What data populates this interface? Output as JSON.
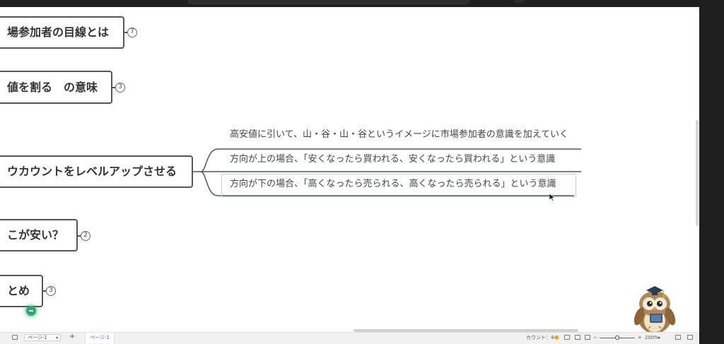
{
  "mindmap": {
    "nodes": [
      {
        "id": "node-market-view",
        "text": "場参加者の目線とは",
        "count": "7"
      },
      {
        "id": "node-value-divide",
        "text": "値を割る　の意味",
        "count": "3"
      },
      {
        "id": "node-level-up",
        "text": "ウカウントをレベルアップさせる",
        "count": ""
      },
      {
        "id": "node-where-cheap",
        "text": "こが安い？",
        "count": "2"
      },
      {
        "id": "node-summary",
        "text": "とめ",
        "count": "3"
      }
    ],
    "children": [
      "高安値に引いて、山・谷・山・谷というイメージに市場参加者の意識を加えていく",
      "方向が上の場合、「安くなったら買われる、安くなったら買われる」という意識",
      "方向が下の場合、「高くなったら売られる、高くなったら売られる」という意識"
    ]
  },
  "statusbar": {
    "page_select": "ページ-1",
    "add": "+",
    "page_tab": "ページ-1",
    "count_label": "カウント：44",
    "zoom_minus": "−",
    "zoom_plus": "+",
    "zoom_value": "200%"
  },
  "colors": {
    "node_border": "#555555",
    "selection": "#b8cde6",
    "accent_green": "#2ea878",
    "tab_text": "#2a8c8c"
  }
}
